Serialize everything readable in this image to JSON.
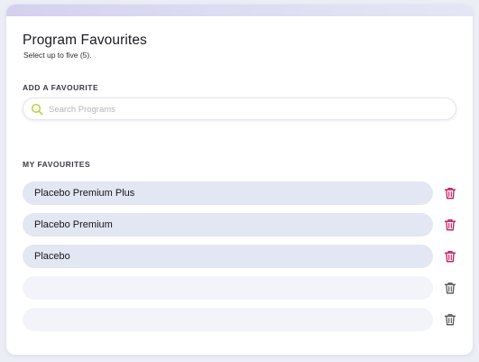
{
  "header": {
    "title": "Program Favourites",
    "subtitle": "Select up to five (5)."
  },
  "add_section": {
    "label": "ADD A FAVOURITE",
    "search_placeholder": "Search Programs",
    "search_value": ""
  },
  "favourites_section": {
    "label": "MY FAVOURITES",
    "items": [
      {
        "name": "Placebo Premium Plus",
        "filled": true
      },
      {
        "name": "Placebo Premium",
        "filled": true
      },
      {
        "name": "Placebo",
        "filled": true
      },
      {
        "name": "",
        "filled": false
      },
      {
        "name": "",
        "filled": false
      }
    ]
  },
  "icons": {
    "search": "search-icon",
    "delete": "trash-icon"
  },
  "colors": {
    "accent_gradient_start": "#d4d0ef",
    "search_icon": "#b9d23c",
    "trash_active": "#c2185b",
    "trash_inactive": "#555555",
    "pill_filled": "#e3e6f3",
    "pill_empty": "#f3f4f9"
  }
}
